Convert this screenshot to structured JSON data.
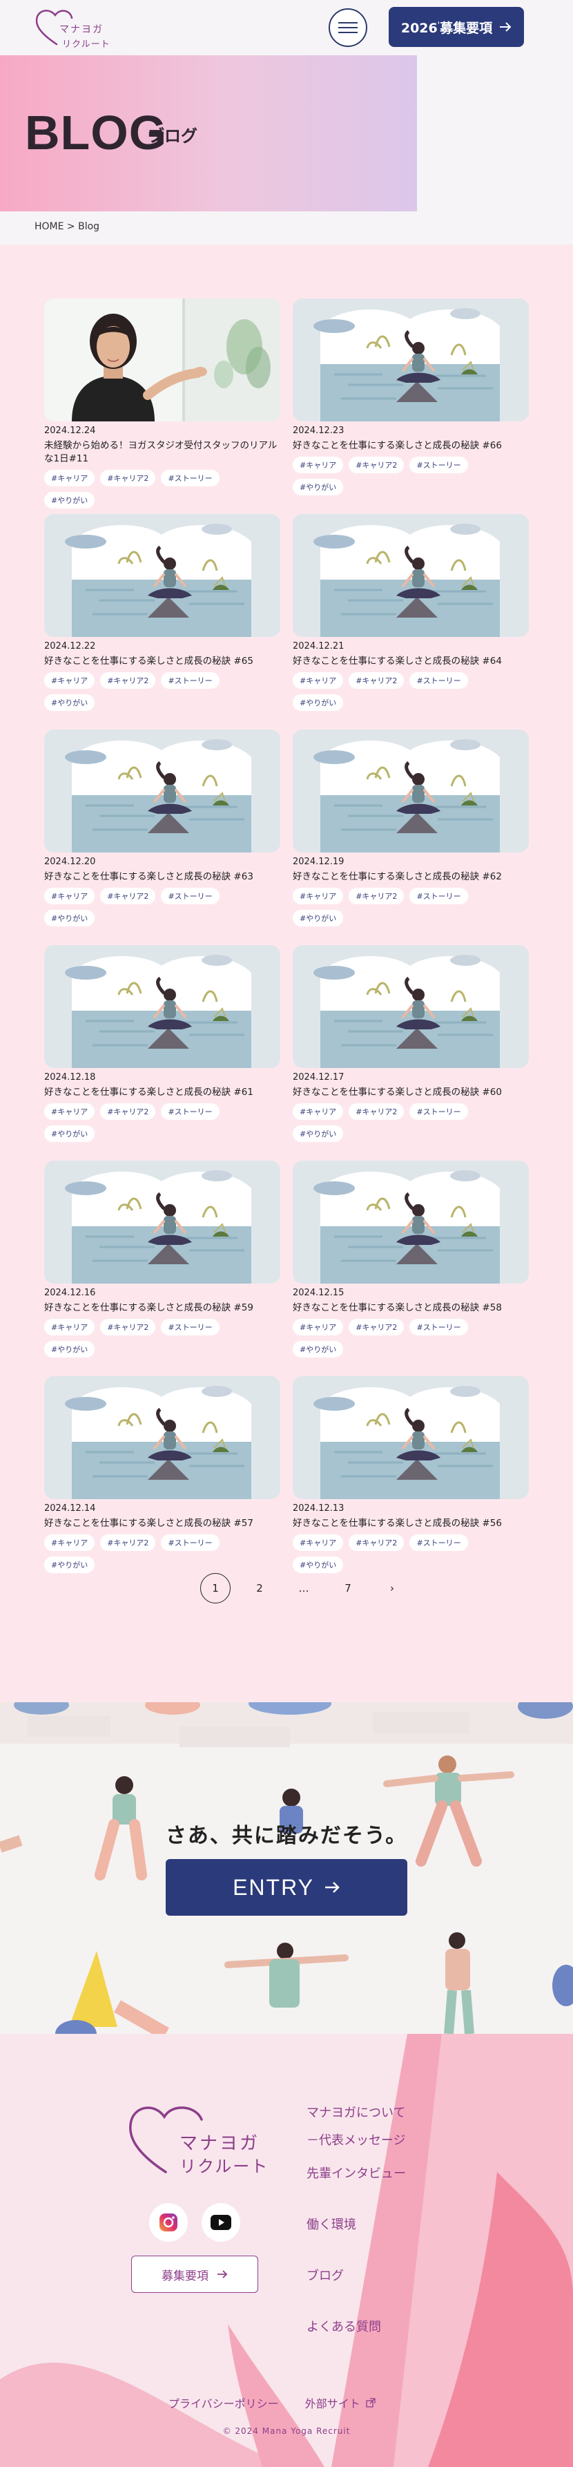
{
  "header": {
    "logo_line1": "マナヨガ",
    "logo_line2": "リクルート",
    "cta_label": "募集要項",
    "cta_year": "2026",
    "cta_sup": "'"
  },
  "hero": {
    "title": "BLOG",
    "subtitle": "ブログ"
  },
  "breadcrumb": {
    "home": "HOME",
    "sep": " > ",
    "current": "Blog"
  },
  "posts": [
    {
      "date": "2024.12.24",
      "title": "未経験から始める！ヨガスタジオ受付スタッフのリアルな1日#11",
      "image": "woman-receptionist-photo",
      "tags": [
        "#キャリア",
        "#キャリア2",
        "#ストーリー",
        "#やりがい"
      ]
    },
    {
      "date": "2024.12.23",
      "title": "好きなことを仕事にする楽しさと成長の秘訣 #66",
      "image": "yoga-meditation-illustration",
      "tags": [
        "#キャリア",
        "#キャリア2",
        "#ストーリー",
        "#やりがい"
      ]
    },
    {
      "date": "2024.12.22",
      "title": "好きなことを仕事にする楽しさと成長の秘訣 #65",
      "image": "yoga-meditation-illustration",
      "tags": [
        "#キャリア",
        "#キャリア2",
        "#ストーリー",
        "#やりがい"
      ]
    },
    {
      "date": "2024.12.21",
      "title": "好きなことを仕事にする楽しさと成長の秘訣 #64",
      "image": "yoga-meditation-illustration",
      "tags": [
        "#キャリア",
        "#キャリア2",
        "#ストーリー",
        "#やりがい"
      ]
    },
    {
      "date": "2024.12.20",
      "title": "好きなことを仕事にする楽しさと成長の秘訣 #63",
      "image": "yoga-meditation-illustration",
      "tags": [
        "#キャリア",
        "#キャリア2",
        "#ストーリー",
        "#やりがい"
      ]
    },
    {
      "date": "2024.12.19",
      "title": "好きなことを仕事にする楽しさと成長の秘訣 #62",
      "image": "yoga-meditation-illustration",
      "tags": [
        "#キャリア",
        "#キャリア2",
        "#ストーリー",
        "#やりがい"
      ]
    },
    {
      "date": "2024.12.18",
      "title": "好きなことを仕事にする楽しさと成長の秘訣 #61",
      "image": "yoga-meditation-illustration",
      "tags": [
        "#キャリア",
        "#キャリア2",
        "#ストーリー",
        "#やりがい"
      ]
    },
    {
      "date": "2024.12.17",
      "title": "好きなことを仕事にする楽しさと成長の秘訣 #60",
      "image": "yoga-meditation-illustration",
      "tags": [
        "#キャリア",
        "#キャリア2",
        "#ストーリー",
        "#やりがい"
      ]
    },
    {
      "date": "2024.12.16",
      "title": "好きなことを仕事にする楽しさと成長の秘訣 #59",
      "image": "yoga-meditation-illustration",
      "tags": [
        "#キャリア",
        "#キャリア2",
        "#ストーリー",
        "#やりがい"
      ]
    },
    {
      "date": "2024.12.15",
      "title": "好きなことを仕事にする楽しさと成長の秘訣 #58",
      "image": "yoga-meditation-illustration",
      "tags": [
        "#キャリア",
        "#キャリア2",
        "#ストーリー",
        "#やりがい"
      ]
    },
    {
      "date": "2024.12.14",
      "title": "好きなことを仕事にする楽しさと成長の秘訣 #57",
      "image": "yoga-meditation-illustration",
      "tags": [
        "#キャリア",
        "#キャリア2",
        "#ストーリー",
        "#やりがい"
      ]
    },
    {
      "date": "2024.12.13",
      "title": "好きなことを仕事にする楽しさと成長の秘訣 #56",
      "image": "yoga-meditation-illustration",
      "tags": [
        "#キャリア",
        "#キャリア2",
        "#ストーリー",
        "#やりがい"
      ]
    }
  ],
  "pagination": {
    "pages": [
      "1",
      "2",
      "…",
      "7"
    ],
    "current": "1",
    "next": "›"
  },
  "entry": {
    "heading": "さあ、共に踏みだそう。",
    "button": "ENTRY"
  },
  "footer": {
    "logo_line1": "マナヨガ",
    "logo_line2": "リクルート",
    "recruit_button": "募集要項",
    "nav": [
      "マナヨガについて",
      "－代表メッセージ",
      "先輩インタビュー",
      "働く環境",
      "ブログ",
      "よくある質問"
    ],
    "privacy": "プライバシーポリシー",
    "external": "外部サイト",
    "copyright": "© 2024 Mana Yoga Recruit"
  },
  "icons": {
    "instagram": "instagram-icon",
    "youtube": "youtube-icon",
    "arrow": "arrow-right-icon",
    "external": "external-link-icon"
  },
  "colors": {
    "navy": "#2b3a7a",
    "purple": "#8d3e8a",
    "pink_bg": "#fde7ed"
  }
}
